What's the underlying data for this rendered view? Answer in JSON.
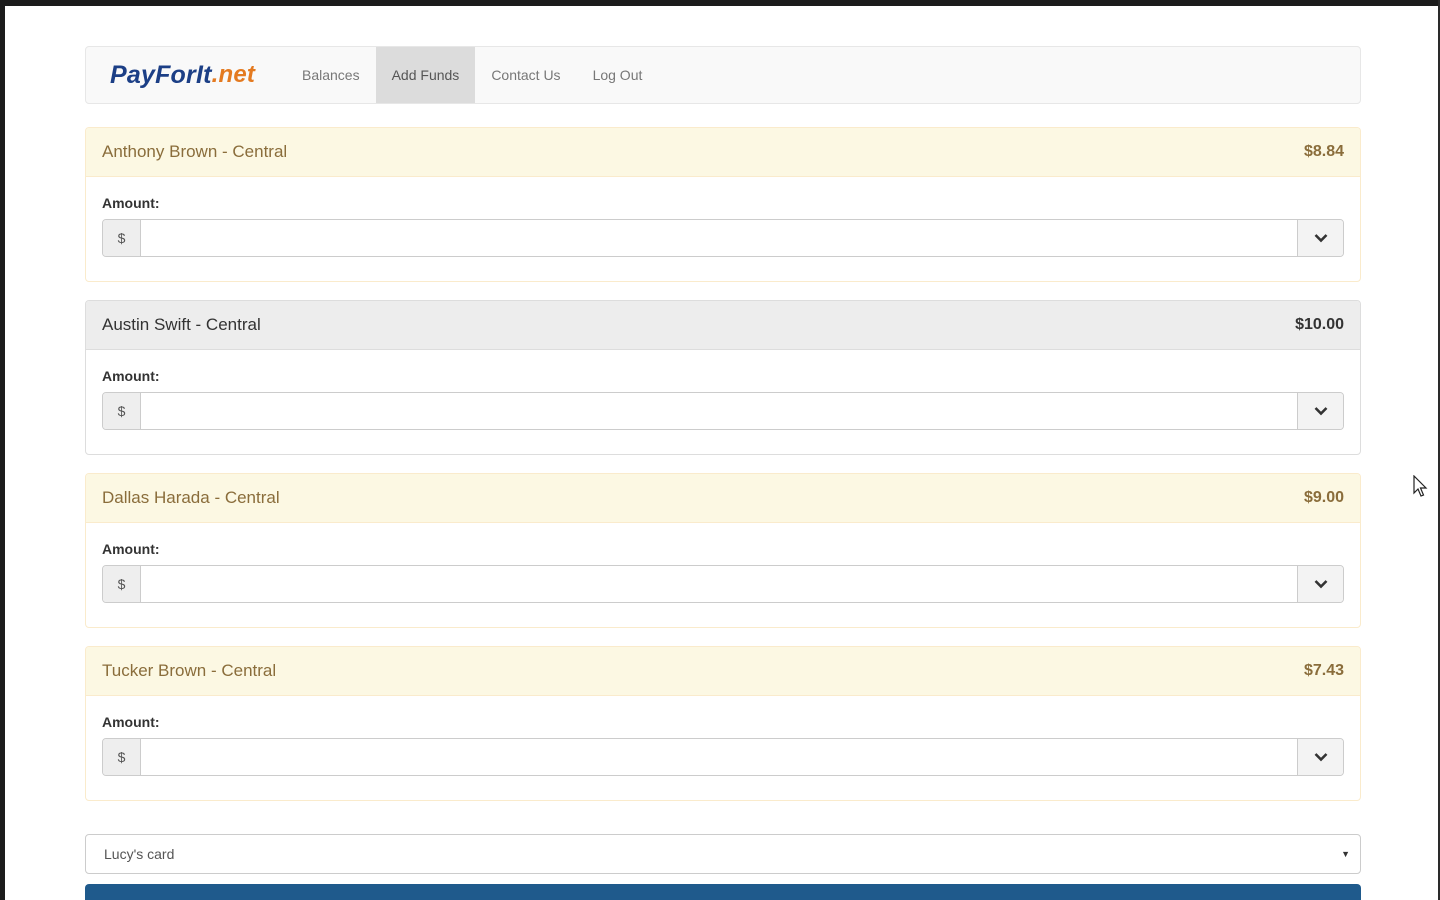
{
  "brand": {
    "part1": "PayForIt",
    "part2": ".net"
  },
  "nav": {
    "items": [
      {
        "label": "Balances",
        "active": false
      },
      {
        "label": "Add Funds",
        "active": true
      },
      {
        "label": "Contact Us",
        "active": false
      },
      {
        "label": "Log Out",
        "active": false
      }
    ]
  },
  "accounts": [
    {
      "name": "Anthony Brown - Central",
      "balance": "$8.84",
      "amount_label": "Amount:",
      "currency": "$",
      "amount_value": "",
      "style": "warning"
    },
    {
      "name": "Austin Swift - Central",
      "balance": "$10.00",
      "amount_label": "Amount:",
      "currency": "$",
      "amount_value": "",
      "style": "default"
    },
    {
      "name": "Dallas Harada - Central",
      "balance": "$9.00",
      "amount_label": "Amount:",
      "currency": "$",
      "amount_value": "",
      "style": "warning"
    },
    {
      "name": "Tucker Brown - Central",
      "balance": "$7.43",
      "amount_label": "Amount:",
      "currency": "$",
      "amount_value": "",
      "style": "warning"
    }
  ],
  "payment": {
    "selected_card": "Lucy's card"
  },
  "colors": {
    "warning_heading_bg": "#fcf8e3",
    "warning_heading_text": "#8a6d3b",
    "default_heading_bg": "#ededed",
    "submit_bar": "#1f5a8c",
    "brand_blue": "#1c3f86",
    "brand_orange": "#e47a20"
  }
}
